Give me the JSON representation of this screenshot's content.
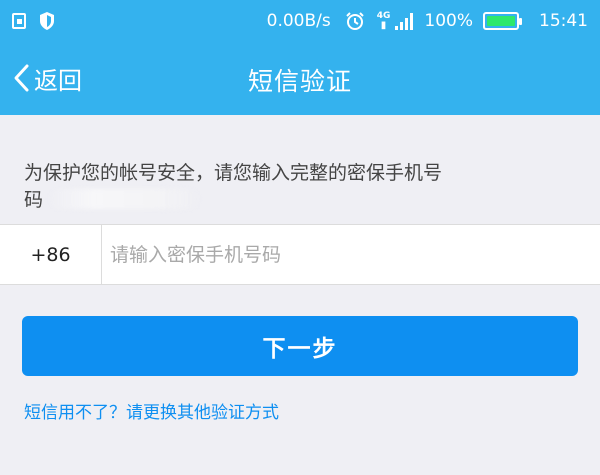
{
  "status_bar": {
    "net_speed": "0.00B/s",
    "network_type": "4G",
    "battery": "100%",
    "time": "15:41",
    "icons": [
      "notification-icon",
      "shield-icon",
      "alarm-icon",
      "lte-icon",
      "signal-icon",
      "battery-icon"
    ],
    "battery_color": "#2ee86c"
  },
  "nav": {
    "back_label": "返回",
    "title": "短信验证",
    "back_icon": "chevron-left-icon",
    "bg_color": "#34b2ee"
  },
  "instruction": {
    "line1": "为保护您的帐号安全，请您输入完整的密保手机号",
    "line2": "码"
  },
  "phone": {
    "country_code": "+86",
    "placeholder": "请输入密保手机号码",
    "value": ""
  },
  "actions": {
    "next_label": "下一步",
    "next_color": "#0e8ff1",
    "alt_link": "短信用不了？请更换其他验证方式"
  }
}
